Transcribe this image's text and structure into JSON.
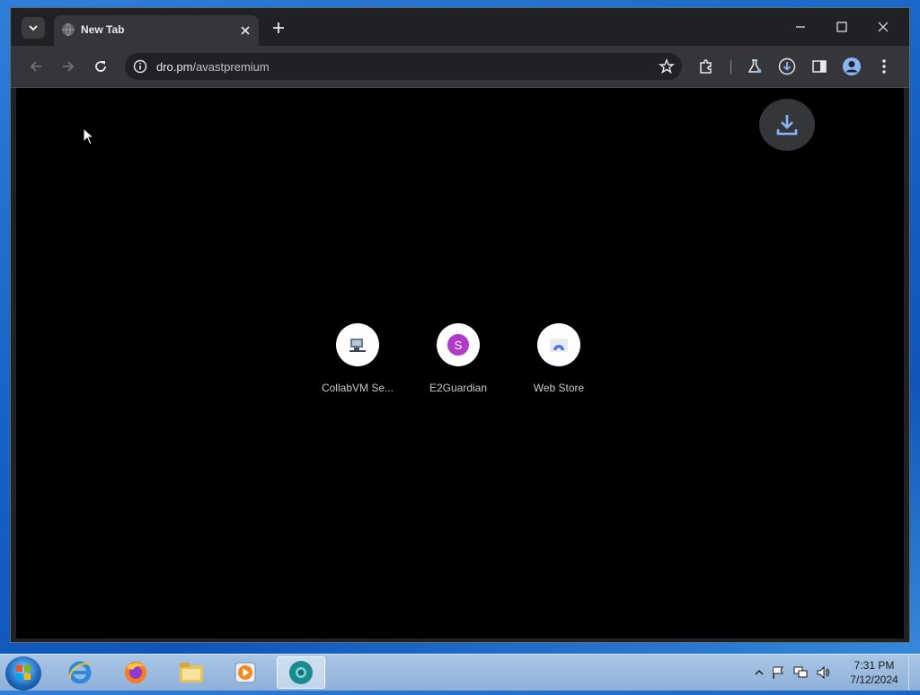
{
  "browser": {
    "tab": {
      "title": "New Tab"
    },
    "address": {
      "host": "dro.pm",
      "path": "/avastpremium"
    }
  },
  "shortcuts": [
    {
      "label": "CollabVM Se...",
      "icon": "collabvm-icon"
    },
    {
      "label": "E2Guardian",
      "icon": "letter-s-icon",
      "letter": "S",
      "color": "#b03bc9"
    },
    {
      "label": "Web Store",
      "icon": "web-store-icon"
    }
  ],
  "taskbar": {
    "apps": [
      "internet-explorer-icon",
      "firefox-icon",
      "file-explorer-icon",
      "media-player-icon",
      "chrome-icon"
    ],
    "time": "7:31 PM",
    "date": "7/12/2024"
  },
  "colors": {
    "accent": "#8ab4f8",
    "content_bg": "#000000",
    "chrome_dark": "#202124"
  }
}
